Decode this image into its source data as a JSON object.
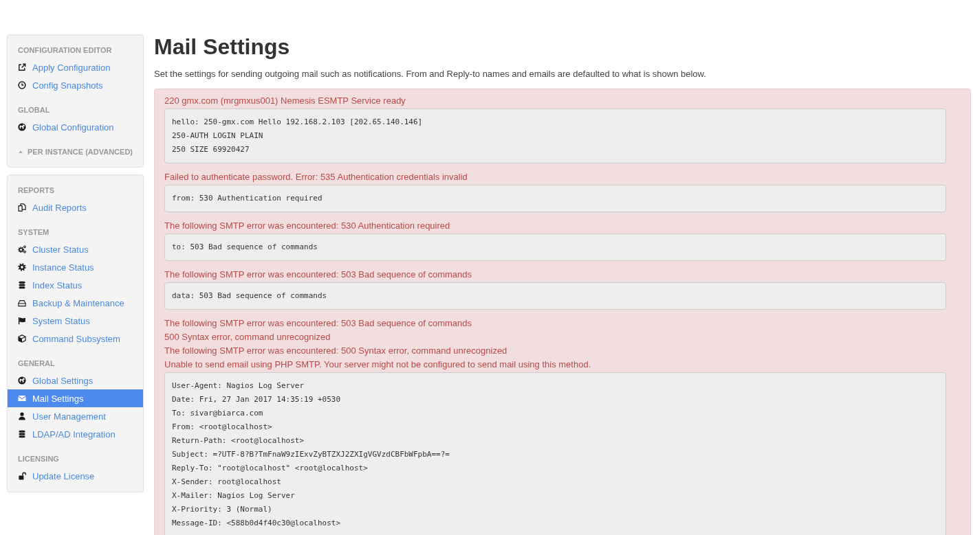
{
  "sidebar": {
    "panels": [
      {
        "sections": [
          {
            "kind": "group",
            "heading": "CONFIGURATION EDITOR",
            "items": [
              {
                "label": "Apply Configuration",
                "selected": false
              },
              {
                "label": "Config Snapshots",
                "selected": false
              }
            ]
          },
          {
            "kind": "group",
            "heading": "GLOBAL",
            "items": [
              {
                "label": "Global Configuration",
                "selected": false
              }
            ]
          },
          {
            "kind": "toggle",
            "heading": "PER INSTANCE (ADVANCED)"
          }
        ]
      },
      {
        "sections": [
          {
            "kind": "group",
            "heading": "REPORTS",
            "items": [
              {
                "label": "Audit Reports",
                "selected": false
              }
            ]
          },
          {
            "kind": "group",
            "heading": "SYSTEM",
            "items": [
              {
                "label": "Cluster Status",
                "selected": false
              },
              {
                "label": "Instance Status",
                "selected": false
              },
              {
                "label": "Index Status",
                "selected": false
              },
              {
                "label": "Backup & Maintenance",
                "selected": false
              },
              {
                "label": "System Status",
                "selected": false
              },
              {
                "label": "Command Subsystem",
                "selected": false
              }
            ]
          },
          {
            "kind": "group",
            "heading": "GENERAL",
            "items": [
              {
                "label": "Global Settings",
                "selected": false
              },
              {
                "label": "Mail Settings",
                "selected": true
              },
              {
                "label": "User Management",
                "selected": false
              },
              {
                "label": "LDAP/AD Integration",
                "selected": false
              }
            ]
          },
          {
            "kind": "group",
            "heading": "LICENSING",
            "items": [
              {
                "label": "Update License",
                "selected": false
              }
            ]
          }
        ]
      }
    ]
  },
  "page": {
    "title": "Mail Settings",
    "description": "Set the settings for sending outgoing mail such as notifications. From and Reply-to names and emails are defaulted to what is shown below."
  },
  "alert": {
    "entries": [
      {
        "kind": "message",
        "text": "220 gmx.com (mrgmxus001) Nemesis ESMTP Service ready"
      },
      {
        "kind": "code",
        "lines": [
          "hello: 250-gmx.com Hello 192.168.2.103 [202.65.140.146]",
          "250-AUTH LOGIN PLAIN",
          "250 SIZE 69920427"
        ]
      },
      {
        "kind": "message",
        "text": "Failed to authenticate password. Error: 535 Authentication credentials invalid"
      },
      {
        "kind": "code",
        "lines": [
          "from: 530 Authentication required"
        ]
      },
      {
        "kind": "message",
        "text": "The following SMTP error was encountered: 530 Authentication required"
      },
      {
        "kind": "code",
        "lines": [
          "to: 503 Bad sequence of commands"
        ]
      },
      {
        "kind": "message",
        "text": "The following SMTP error was encountered: 503 Bad sequence of commands"
      },
      {
        "kind": "code",
        "lines": [
          "data: 503 Bad sequence of commands"
        ]
      },
      {
        "kind": "message",
        "text": "The following SMTP error was encountered: 503 Bad sequence of commands"
      },
      {
        "kind": "message",
        "text": "500 Syntax error, command unrecognized"
      },
      {
        "kind": "message",
        "text": "The following SMTP error was encountered: 500 Syntax error, command unrecognized"
      },
      {
        "kind": "message",
        "text": "Unable to send email using PHP SMTP. Your server might not be configured to send mail using this method."
      },
      {
        "kind": "code",
        "lines": [
          "User-Agent: Nagios Log Server",
          "Date: Fri, 27 Jan 2017 14:35:19 +0530",
          "To: sivar@biarca.com",
          "From: <root@localhost>",
          "Return-Path: <root@localhost>",
          "Subject: =?UTF-8?B?TmFnaW9zIExvZyBTZXJ2ZXIgVGVzdCBFbWFpbA==?=",
          "Reply-To: \"root@localhost\" <root@localhost>",
          "X-Sender: root@localhost",
          "X-Mailer: Nagios Log Server",
          "X-Priority: 3 (Normal)",
          "Message-ID: <588b0d4f40c30@localhost>"
        ]
      }
    ]
  }
}
